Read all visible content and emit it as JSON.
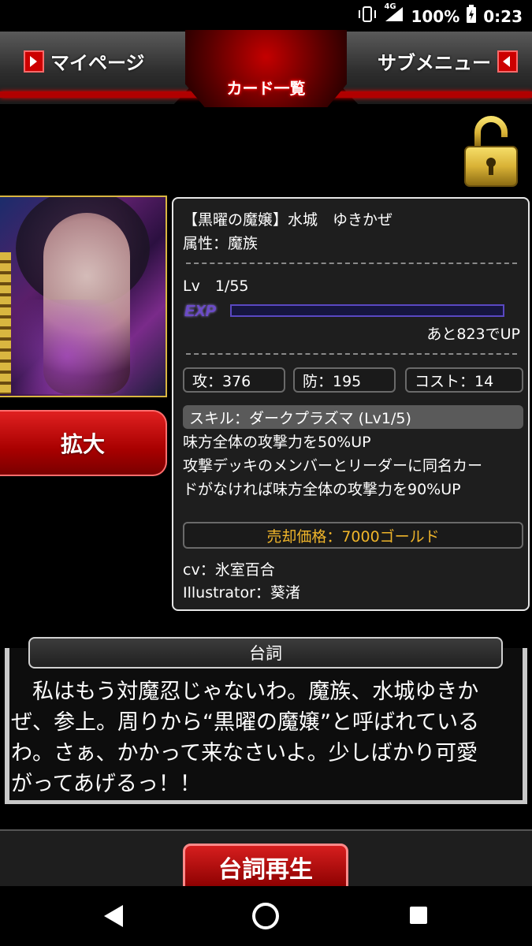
{
  "status_bar": {
    "network": "4G",
    "battery": "100%",
    "time": "0:23"
  },
  "header": {
    "left_button": "マイページ",
    "right_button": "サブメニュー",
    "title": "カード一覧"
  },
  "lock": {
    "icon": "padlock-open-icon",
    "color": "#d9b236"
  },
  "card_image": {
    "description_icon": "card-art"
  },
  "zoom_button": "拡大",
  "info": {
    "name": "【黒曜の魔嬢】水城　ゆきかぜ",
    "attribute": "属性：魔族",
    "level": "Lv　1/55",
    "exp_label": "EXP",
    "exp_progress": 0,
    "exp_remaining": "あと823でUP",
    "attack": "攻：376",
    "defense": "防：195",
    "cost": "コスト：14",
    "skill_name": "スキル：ダークプラズマ (Lv1/5)",
    "skill_desc_1": "味方全体の攻撃力を50%UP",
    "skill_desc_2": "攻撃デッキのメンバーとリーダーに同名カー",
    "skill_desc_3": "ドがなければ味方全体の攻撃力を90%UP",
    "sell_price": "売却価格：7000ゴールド",
    "cv": "cv：氷室百合",
    "illustrator": "Illustrator：葵渚"
  },
  "dialogue": {
    "title": "台詞",
    "line1": "　私はもう対魔忍じゃないわ。魔族、水城ゆきか",
    "line2": "ぜ、参上。周りから“黒曜の魔嬢”と呼ばれている",
    "line3": "わ。さぁ、かかって来なさいよ。少しばかり可愛",
    "line4": "がってあげるっ！！"
  },
  "replay_button": "台詞再生",
  "colors": {
    "accent_red": "#c00000",
    "gold": "#f0b52a",
    "exp_purple": "#6b4ac9"
  }
}
